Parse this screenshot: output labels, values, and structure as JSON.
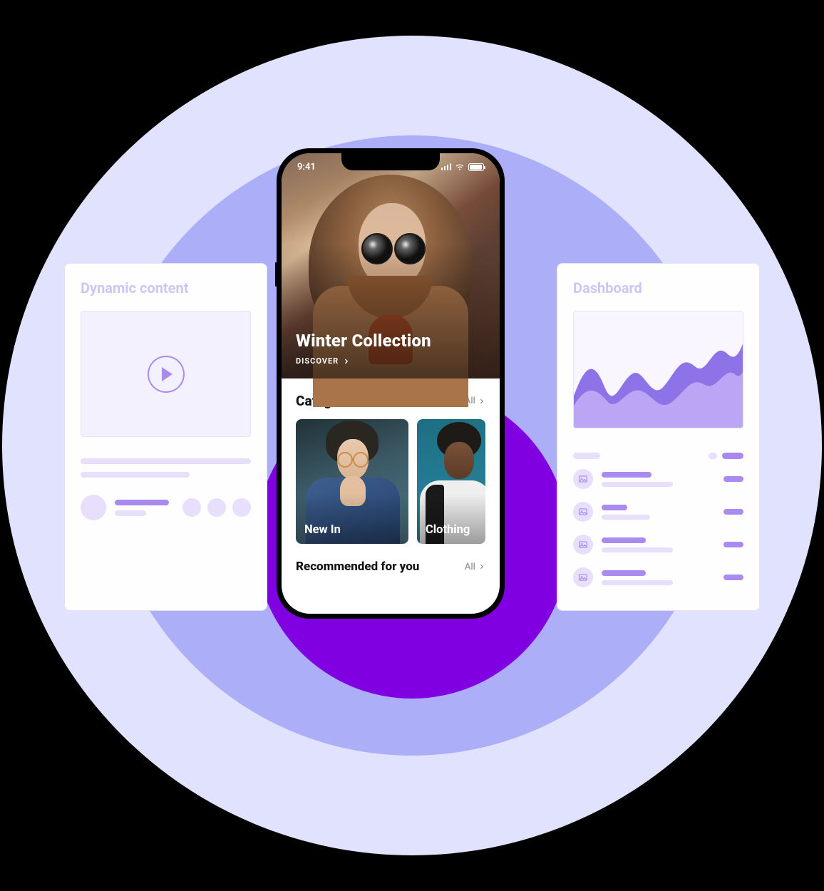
{
  "left_card": {
    "title": "Dynamic content"
  },
  "right_card": {
    "title": "Dashboard"
  },
  "phone": {
    "status_time": "9:41",
    "hero": {
      "title": "Winter Collection",
      "cta": "DISCOVER"
    },
    "categories": {
      "heading": "Categories",
      "all_label": "All",
      "items": [
        {
          "label": "New In"
        },
        {
          "label": "Clothing"
        }
      ]
    },
    "recommended": {
      "heading": "Recommended for you",
      "all_label": "All"
    }
  }
}
